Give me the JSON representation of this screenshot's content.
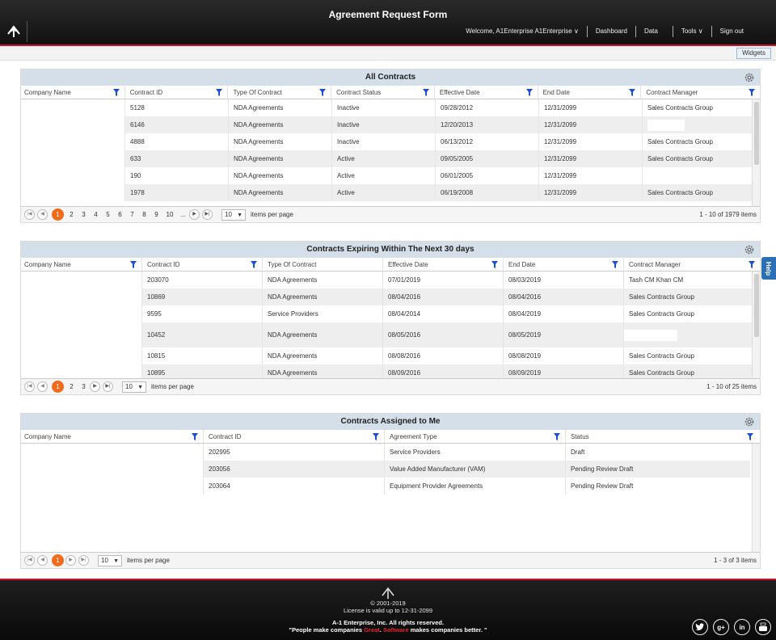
{
  "header": {
    "title": "Agreement Request Form",
    "welcome": "Welcome, A1Enterprise A1Enterprise",
    "welcome_caret": "∨",
    "nav": {
      "dashboard": "Dashboard",
      "data": "Data",
      "tools": "Tools",
      "tools_caret": "∨",
      "signout": "Sign out"
    }
  },
  "toolbar": {
    "widgets_label": "Widgets"
  },
  "help_label": "Help",
  "panels": {
    "all": {
      "title": "All Contracts",
      "columns": [
        "Company Name",
        "Contract ID",
        "Type Of Contract",
        "Contract Status",
        "Effective Date",
        "End Date",
        "Contract Manager"
      ],
      "rows": [
        [
          "",
          "5128",
          "NDA Agreements",
          "Inactive",
          "09/28/2012",
          "12/31/2099",
          "Sales Contracts Group"
        ],
        [
          "",
          "6146",
          "NDA Agreements",
          "Inactive",
          "12/20/2013",
          "12/31/2099",
          ""
        ],
        [
          "",
          "4888",
          "NDA Agreements",
          "Inactive",
          "06/13/2012",
          "12/31/2099",
          "Sales Contracts Group"
        ],
        [
          "",
          "633",
          "NDA Agreements",
          "Active",
          "09/05/2005",
          "12/31/2099",
          "Sales Contracts Group"
        ],
        [
          "",
          "190",
          "NDA Agreements",
          "Active",
          "06/01/2005",
          "12/31/2099",
          ""
        ],
        [
          "",
          "1978",
          "NDA Agreements",
          "Active",
          "06/19/2008",
          "12/31/2099",
          "Sales Contracts Group"
        ]
      ],
      "pages": [
        "1",
        "2",
        "3",
        "4",
        "5",
        "6",
        "7",
        "8",
        "9",
        "10",
        "..."
      ],
      "page_size": "10",
      "per_page_label": "items per page",
      "info": "1 - 10 of 1979 items"
    },
    "expiring": {
      "title": "Contracts Expiring Within The Next 30 days",
      "columns": [
        "Company Name",
        "Contract ID",
        "Type Of Contract",
        "Effective Date",
        "End Date",
        "Contract Manager"
      ],
      "rows": [
        [
          "",
          "203070",
          "NDA Agreements",
          "07/01/2019",
          "08/03/2019",
          "Tash CM Khan CM"
        ],
        [
          "",
          "10869",
          "NDA Agreements",
          "08/04/2016",
          "08/04/2016",
          "Sales Contracts Group"
        ],
        [
          "",
          "9595",
          "Service Providers",
          "08/04/2014",
          "08/04/2019",
          "Sales Contracts Group"
        ],
        [
          "",
          "10452",
          "NDA Agreements",
          "08/05/2016",
          "08/05/2019",
          ""
        ],
        [
          "",
          "10815",
          "NDA Agreements",
          "08/08/2016",
          "08/08/2019",
          "Sales Contracts Group"
        ],
        [
          "",
          "10895",
          "NDA Agreements",
          "08/09/2016",
          "08/09/2019",
          "Sales Contracts Group"
        ]
      ],
      "pages": [
        "1",
        "2",
        "3"
      ],
      "page_size": "10",
      "per_page_label": "items per page",
      "info": "1 - 10 of 25 items"
    },
    "assigned": {
      "title": "Contracts Assigned to Me",
      "columns": [
        "Company Name",
        "Contract ID",
        "Agreement Type",
        "Status"
      ],
      "rows": [
        [
          "",
          "202995",
          "Service Providers",
          "Draft"
        ],
        [
          "",
          "203056",
          "Value Added Manufacturer (VAM)",
          "Pending Review Draft"
        ],
        [
          "",
          "203064",
          "Equipment Provider Agreements",
          "Pending Review Draft"
        ]
      ],
      "pages": [
        "1"
      ],
      "page_size": "10",
      "per_page_label": "items per page",
      "info": "1 - 3 of 3 items"
    }
  },
  "footer": {
    "copyright": "© 2001-2019",
    "license": "License is valid up to 12-31-2099",
    "rights": "A-1 Enterprise, Inc. All rights reserved.",
    "slogan_pre": "\"People make companies ",
    "slogan_great": "Great",
    "slogan_mid": ". ",
    "slogan_software": "Software",
    "slogan_post": " makes companies better. \"",
    "social": [
      "twitter",
      "google-plus",
      "linkedin",
      "youtube"
    ]
  },
  "colors": {
    "accent_red": "#c8102e",
    "active_page": "#f26b1d",
    "panel_header": "#d5dfe9",
    "filter_icon": "#1a4fd6"
  }
}
